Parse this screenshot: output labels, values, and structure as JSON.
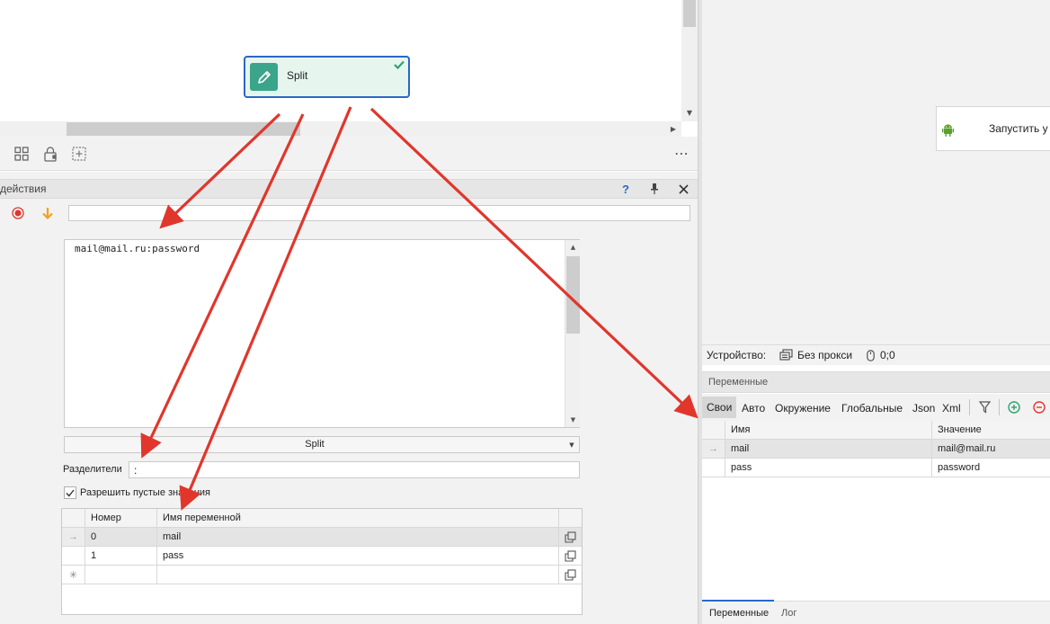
{
  "canvas": {
    "node": {
      "label": "Split",
      "icon": "pencil-icon",
      "status_icon": "check-icon"
    }
  },
  "toolbar": {
    "icons": [
      "grid-icon",
      "lock-icon",
      "add-block-icon"
    ],
    "more": "⋯"
  },
  "action_panel": {
    "title": "действия",
    "help": "?",
    "input_value": "mail@mail.ru:password",
    "mode_select": "Split",
    "separators_label": "Разделители",
    "separators_value": ":",
    "allow_empty_label": "Разрешить пустые значения",
    "table": {
      "columns": [
        "Номер",
        "Имя переменной"
      ],
      "rows": [
        {
          "number": "0",
          "name": "mail"
        },
        {
          "number": "1",
          "name": "pass"
        }
      ]
    }
  },
  "device_panel": {
    "start_button": "Запустить у",
    "device_label": "Устройство:",
    "proxy_label": "Без прокси",
    "coords": "0;0"
  },
  "variables_panel": {
    "title": "Переменные",
    "tabs": [
      "Свои",
      "Авто",
      "Окружение",
      "Глобальные",
      "Json",
      "Xml"
    ],
    "columns": [
      "Имя",
      "Значение"
    ],
    "rows": [
      {
        "name": "mail",
        "value": "mail@mail.ru"
      },
      {
        "name": "pass",
        "value": "password"
      }
    ]
  },
  "bottom_tabs": [
    "Переменные",
    "Лог"
  ],
  "colors": {
    "accent": "#3aa58a",
    "node_border": "#2a67c9",
    "arrow": "#e0362c",
    "panel_bg": "#f2f2f2",
    "header_bg": "#e6e6e6"
  }
}
